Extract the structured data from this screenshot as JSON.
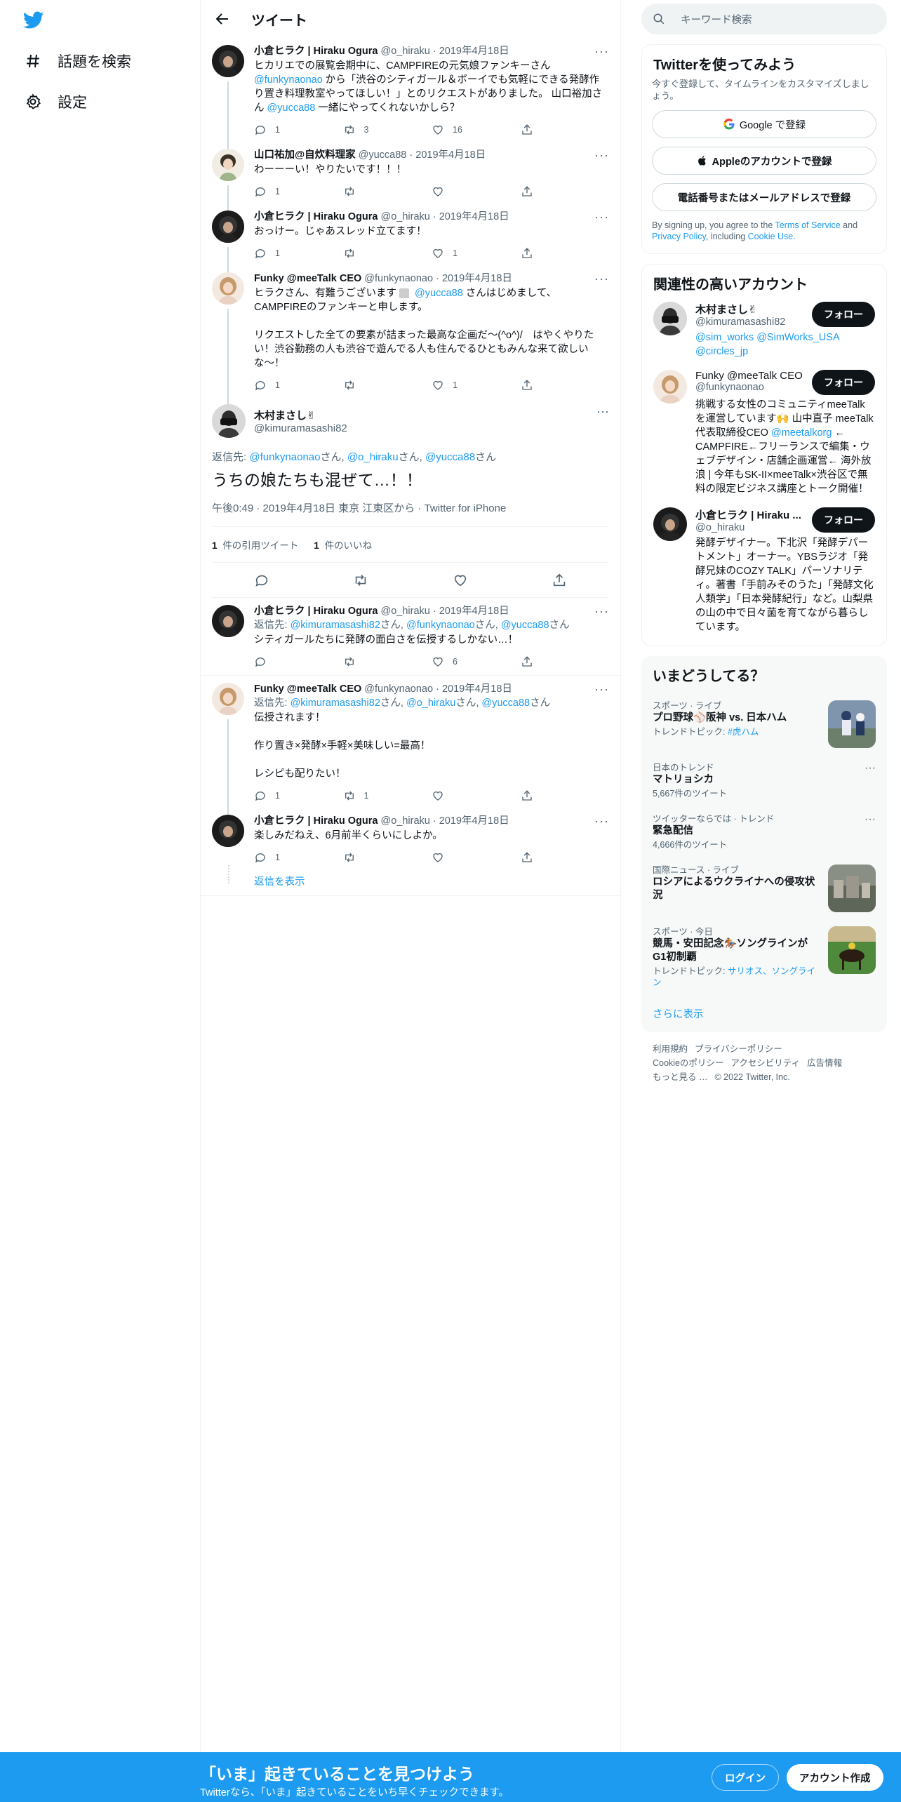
{
  "nav": {
    "explore_label": "話題を検索",
    "settings_label": "設定"
  },
  "header": {
    "title": "ツイート"
  },
  "thread": [
    {
      "name": "小倉ヒラク | Hiraku Ogura",
      "handle": "@o_hiraku",
      "date": "2019年4月18日",
      "text_before": "ヒカリエでの展覧会期中に、CAMPFIREの元気娘ファンキーさん\n",
      "mention1": "@funkynaonao",
      "text_mid": " から「渋谷のシティガール＆ボーイでも気軽にできる発酵作り置き料理教室やってほしい！」とのリクエストがありました。 山口裕加さん ",
      "mention2": "@yucca88",
      "text_after": " 一緒にやってくれないかしら？",
      "replies": "1",
      "retweets": "3",
      "likes": "16"
    },
    {
      "name": "山口祐加@自炊料理家",
      "handle": "@yucca88",
      "date": "2019年4月18日",
      "text": "わーーーい！やりたいです！！！",
      "replies": "1",
      "retweets": "",
      "likes": ""
    },
    {
      "name": "小倉ヒラク | Hiraku Ogura",
      "handle": "@o_hiraku",
      "date": "2019年4月18日",
      "text": "おっけー。じゃあスレッド立てます！",
      "replies": "1",
      "retweets": "",
      "likes": "1"
    },
    {
      "name": "Funky @meeTalk CEO",
      "handle": "@funkynaonao",
      "date": "2019年4月18日",
      "text_before": "ヒラクさん、有難うございます",
      "mention1": "@yucca88",
      "text_after": " さんはじめまして、CAMPFIREのファンキーと申します。\n\nリクエストした全ての要素が詰まった最高な企画だ〜(^o^)/　はやくやりたい！渋谷勤務の人も渋谷で遊んでる人も住んでるひともみんな来て欲しいな〜！",
      "replies": "1",
      "retweets": "",
      "likes": "1"
    }
  ],
  "main_tweet": {
    "name": "木村まさし✌",
    "handle": "@kimuramasashi82",
    "reply_prefix": "返信先: ",
    "reply_to": [
      "@funkynaonao",
      "@o_hiraku",
      "@yucca88"
    ],
    "san": "さん",
    "comma": ", ",
    "text": "うちの娘たちも混ぜて…！！",
    "time": "午後0:49 · 2019年4月18日 東京 江東区から · Twitter for iPhone",
    "quote_count": "1",
    "quote_label": "件の引用ツイート",
    "like_count": "1",
    "like_label": "件のいいね"
  },
  "replies": [
    {
      "name": "小倉ヒラク | Hiraku Ogura",
      "handle": "@o_hiraku",
      "date": "2019年4月18日",
      "reply_to": [
        "@kimuramasashi82",
        "@funkynaonao",
        "@yucca88"
      ],
      "text": "シティガールたちに発酵の面白さを伝授するしかない…！",
      "replies": "",
      "retweets": "",
      "likes": "6"
    },
    {
      "name": "Funky @meeTalk CEO",
      "handle": "@funkynaonao",
      "date": "2019年4月18日",
      "reply_to": [
        "@kimuramasashi82",
        "@o_hiraku",
        "@yucca88"
      ],
      "text": "伝授されます！\n\n作り置き×発酵×手軽×美味しい=最高！\n\nレシピも配りたい！",
      "replies": "1",
      "retweets": "1",
      "likes": ""
    },
    {
      "name": "小倉ヒラク | Hiraku Ogura",
      "handle": "@o_hiraku",
      "date": "2019年4月18日",
      "text": "楽しみだねえ、6月前半くらいにしよか。",
      "replies": "1",
      "retweets": "",
      "likes": ""
    }
  ],
  "show_replies": "返信を表示",
  "search": {
    "placeholder": "キーワード検索"
  },
  "signup_card": {
    "title": "Twitterを使ってみよう",
    "subtitle": "今すぐ登録して、タイムラインをカスタマイズしましょう。",
    "google": "Google で登録",
    "apple": "Appleのアカウントで登録",
    "email": "電話番号またはメールアドレスで登録",
    "legal_1": "By signing up, you agree to the ",
    "tos": "Terms of Service",
    "legal_2": " and ",
    "privacy": "Privacy Policy",
    "legal_3": ", including ",
    "cookie": "Cookie Use",
    "legal_4": "."
  },
  "relevant": {
    "title": "関連性の高いアカウント",
    "follow_label": "フォロー",
    "accounts": [
      {
        "name": "木村まさし✌",
        "handle": "@kimuramasashi82",
        "bio_links": "@sim_works @SimWorks_USA @circles_jp"
      },
      {
        "name": "Funky @meeTalk CEO",
        "handle": "@funkynaonao",
        "bio_1": "挑戦する女性のコミュニティmeeTalkを運営しています🙌 山中直子 meeTalk 代表取締役CEO ",
        "bio_link": "@meetalkorg",
        "bio_2": " ← CAMPFIRE←フリーランスで編集・ウェブデザイン・店舗企画運営← 海外放浪 | 今年もSK-II×meeTalk×渋谷区で無料の限定ビジネス講座とトーク開催！"
      },
      {
        "name": "小倉ヒラク | Hiraku ...",
        "handle": "@o_hiraku",
        "bio": "発酵デザイナー。下北沢「発酵デパートメント」オーナー。YBSラジオ「発酵兄妹のCOZY TALK」パーソナリティ。著書「手前みそのうた」「発酵文化人類学」「日本発酵紀行」など。山梨県の山の中で日々菌を育てながら暮らしています。"
      }
    ]
  },
  "trends": {
    "title": "いまどうしてる？",
    "items": [
      {
        "context": "スポーツ · ライブ",
        "title": "プロ野球⚾阪神 vs. 日本ハム",
        "sub_prefix": "トレンドトピック: ",
        "sub_link": "#虎ハム"
      },
      {
        "context": "日本のトレンド",
        "title": "マトリョシカ",
        "sub": "5,667件のツイート"
      },
      {
        "context": "ツイッターならでは · トレンド",
        "title": "緊急配信",
        "sub": "4,666件のツイート"
      },
      {
        "context": "国際ニュース · ライブ",
        "title": "ロシアによるウクライナへの侵攻状況"
      },
      {
        "context": "スポーツ · 今日",
        "title": "競馬・安田記念🏇ソングラインがG1初制覇",
        "sub_prefix": "トレンドトピック: ",
        "sub_link": "サリオス、ソングライン"
      }
    ],
    "show_more": "さらに表示"
  },
  "footer": {
    "terms": "利用規約",
    "privacy": "プライバシーポリシー",
    "cookie": "Cookieのポリシー",
    "accessibility": "アクセシビリティ",
    "ads": "広告情報",
    "more": "もっと見る …",
    "copyright": "© 2022 Twitter, Inc."
  },
  "bottom_bar": {
    "title": "「いま」起きていることを見つけよう",
    "subtitle": "Twitterなら、「いま」起きていることをいち早くチェックできます。",
    "login": "ログイン",
    "signup": "アカウント作成"
  },
  "colors": {
    "accent": "#1d9bf0",
    "text": "#0f1419",
    "muted": "#536471"
  }
}
